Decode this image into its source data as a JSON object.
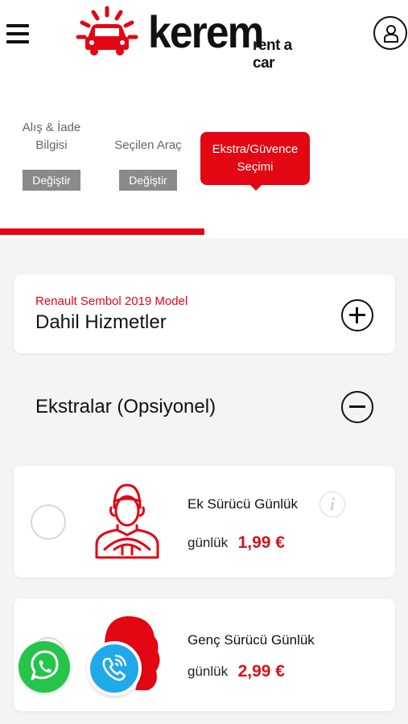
{
  "header": {
    "logo_text": "kerem",
    "logo_subtext": "rent a car",
    "menu_icon": "hamburger-menu-icon",
    "account_icon": "user-account-icon"
  },
  "steps": {
    "step1_label": "Alış & İade Bilgisi",
    "step2_label": "Seçilen Araç",
    "step3_label": "Ekstra/Güvence Seçimi",
    "change_label": "Değiştir",
    "progress_fraction": 0.5
  },
  "included_services": {
    "car_model": "Renault Sembol 2019 Model",
    "title": "Dahil Hizmetler",
    "toggle_icon": "plus-circle-icon"
  },
  "extras": {
    "title": "Ekstralar (Opsiyonel)",
    "toggle_icon": "minus-circle-icon",
    "items": [
      {
        "name": "Ek Sürücü Günlük",
        "period_label": "günlük",
        "price": "1,99 €",
        "icon": "driver-icon"
      },
      {
        "name": "Genç Sürücü Günlük",
        "period_label": "günlük",
        "price": "2,99 €",
        "icon": "young-driver-icon"
      }
    ]
  },
  "floating": {
    "whatsapp_icon": "whatsapp-icon",
    "call_icon": "phone-call-icon"
  },
  "colors": {
    "brand_red": "#e30613",
    "price_red": "#d2141e",
    "whatsapp_green": "#25c44a",
    "call_blue": "#1fa9e8"
  }
}
